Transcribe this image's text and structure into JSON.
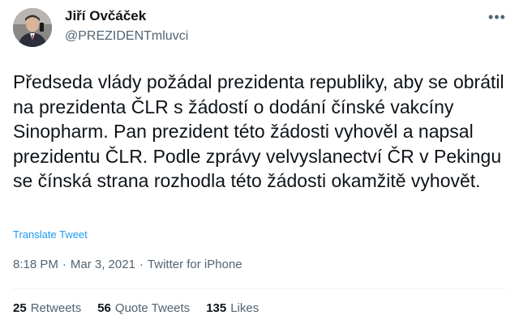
{
  "author": {
    "name": "Jiří Ovčáček",
    "handle": "@PREZIDENTmluvci"
  },
  "tweet": {
    "text": "Předseda vlády požádal prezidenta republiky, aby se obrátil na prezidenta ČLR s žádostí o dodání čínské vakcíny Sinopharm. Pan prezident této žádosti vyhověl a napsal prezidentu ČLR. Podle zprávy velvyslanectví ČR v Pekingu se čínská strana rozhodla této žádosti okamžitě vyhovět.",
    "translate_label": "Translate Tweet"
  },
  "meta": {
    "time": "8:18 PM",
    "separator1": "·",
    "date": "Mar 3, 2021",
    "separator2": "·",
    "source": "Twitter for iPhone"
  },
  "stats": {
    "retweets_count": "25",
    "retweets_label": "Retweets",
    "quotes_count": "56",
    "quotes_label": "Quote Tweets",
    "likes_count": "135",
    "likes_label": "Likes"
  },
  "icons": {
    "more": "more-dots-icon",
    "avatar": "profile-photo"
  },
  "colors": {
    "link": "#1d9bf0",
    "secondary_text": "#536471",
    "primary_text": "#0f1419"
  }
}
